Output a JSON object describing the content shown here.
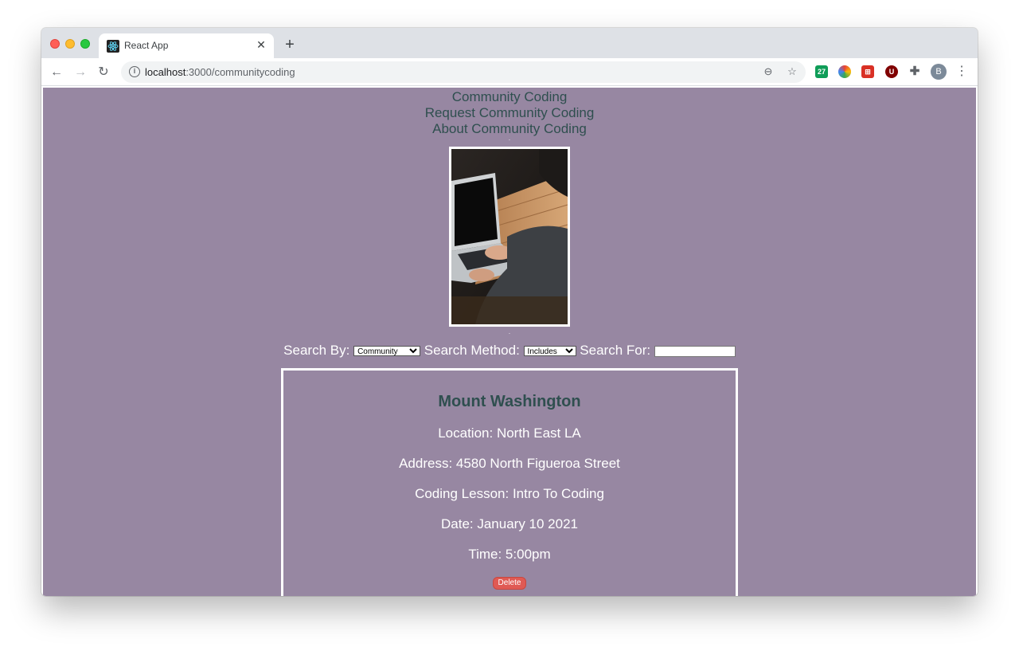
{
  "browser": {
    "tab_title": "React App",
    "url_host": "localhost",
    "url_path": ":3000/communitycoding",
    "avatar_initial": "B",
    "extensions": [
      {
        "name": "calendar-extension-icon",
        "label": "27",
        "color": "#0f9d58"
      },
      {
        "name": "color-picker-extension-icon",
        "label": "",
        "color": "#e8710a"
      },
      {
        "name": "red-extension-icon",
        "label": "",
        "color": "#d93025"
      },
      {
        "name": "ublock-extension-icon",
        "label": "U",
        "color": "#800000"
      },
      {
        "name": "puzzle-extensions-icon",
        "label": "",
        "color": "#5f6368"
      }
    ]
  },
  "nav": {
    "links": [
      "Community Coding",
      "Request Community Coding",
      "About Community Coding"
    ]
  },
  "search": {
    "by_label": "Search By:",
    "by_value": "Community",
    "method_label": "Search Method:",
    "method_value": "Includes",
    "for_label": "Search For:",
    "for_value": ""
  },
  "card": {
    "title": "Mount Washington",
    "location": "Location: North East LA",
    "address": "Address: 4580 North Figueroa Street",
    "lesson": "Coding Lesson: Intro To Coding",
    "date": "Date: January 10 2021",
    "time": "Time: 5:00pm",
    "delete_label": "Delete"
  },
  "colors": {
    "page_bg": "#9787a2",
    "link_color": "#2f4f4f",
    "delete_bg": "#e05a54"
  }
}
